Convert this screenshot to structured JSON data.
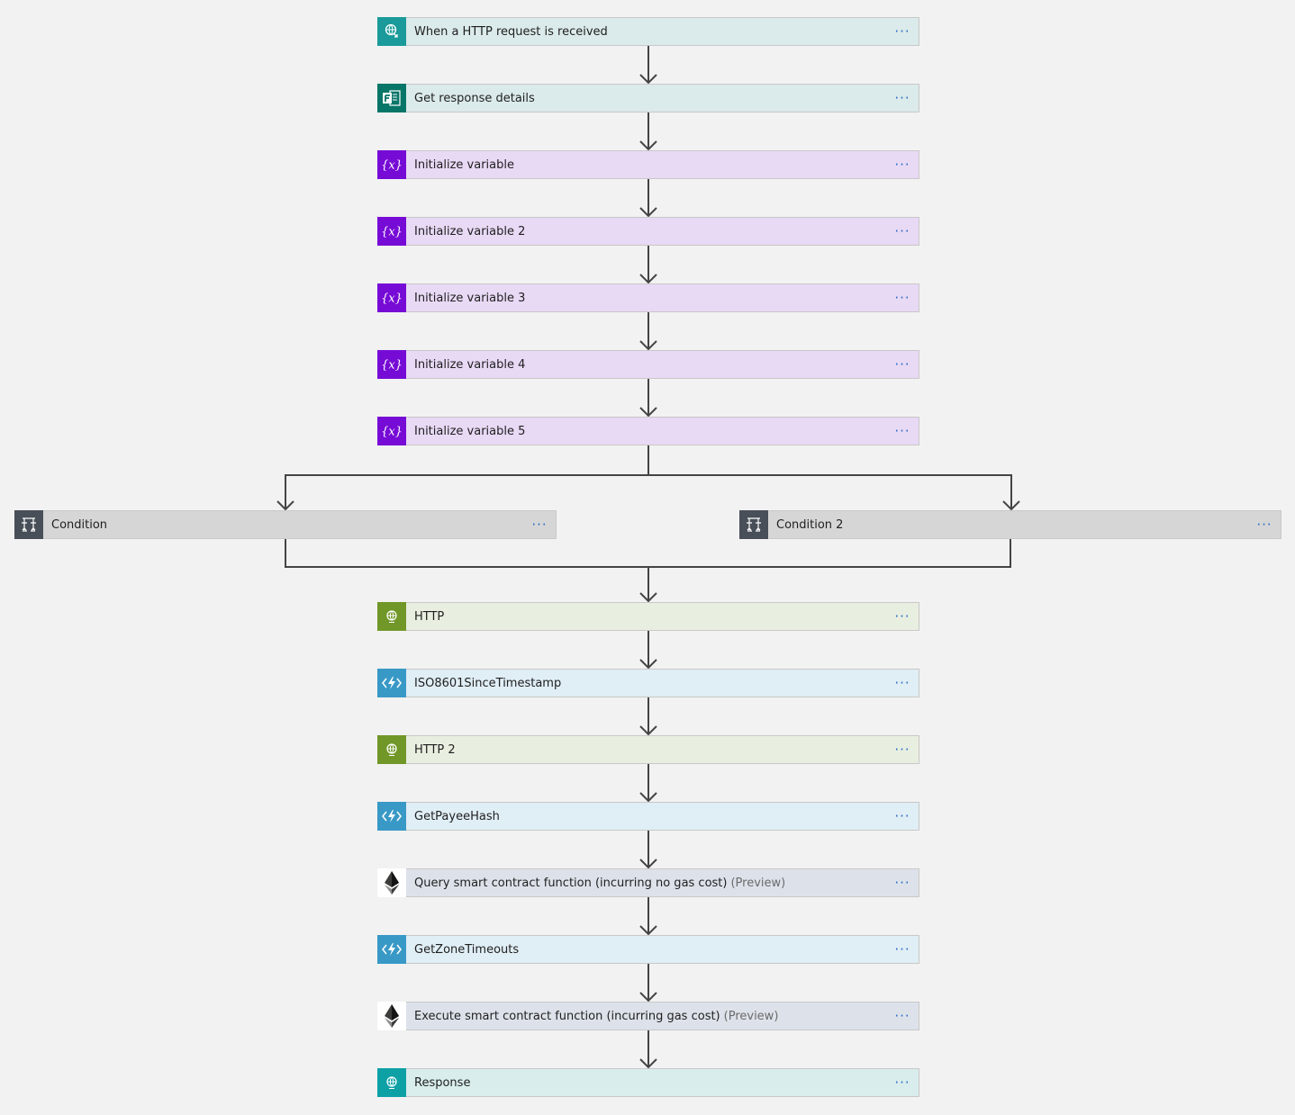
{
  "steps": [
    {
      "title": "When a HTTP request is received",
      "icon": "http-request-trigger-icon"
    },
    {
      "title": "Get response details",
      "icon": "forms-icon"
    },
    {
      "title": "Initialize variable",
      "icon": "variable-icon"
    },
    {
      "title": "Initialize variable 2",
      "icon": "variable-icon"
    },
    {
      "title": "Initialize variable 3",
      "icon": "variable-icon"
    },
    {
      "title": "Initialize variable 4",
      "icon": "variable-icon"
    },
    {
      "title": "Initialize variable 5",
      "icon": "variable-icon"
    }
  ],
  "conditions": [
    {
      "title": "Condition",
      "icon": "condition-icon"
    },
    {
      "title": "Condition 2",
      "icon": "condition-icon"
    }
  ],
  "after_steps": [
    {
      "title": "HTTP",
      "icon": "http-globe-icon"
    },
    {
      "title": "ISO8601SinceTimestamp",
      "icon": "azure-function-icon"
    },
    {
      "title": "HTTP 2",
      "icon": "http-globe-icon"
    },
    {
      "title": "GetPayeeHash",
      "icon": "azure-function-icon"
    },
    {
      "title": "Query smart contract function (incurring no gas cost)",
      "suffix": "(Preview)",
      "icon": "ethereum-icon"
    },
    {
      "title": "GetZoneTimeouts",
      "icon": "azure-function-icon"
    },
    {
      "title": "Execute smart contract function (incurring gas cost)",
      "suffix": "(Preview)",
      "icon": "ethereum-icon"
    },
    {
      "title": "Response",
      "icon": "response-globe-icon"
    }
  ],
  "more_label": "···",
  "colors": {
    "teal_icon": "#1a9a9a",
    "teal_bg": "#dbeaea",
    "forms_icon": "#077568",
    "forms_bg": "#dbeaea",
    "variable_icon": "#770bd6",
    "variable_bg": "#e8d9f5",
    "condition_icon": "#484f58",
    "condition_bg": "#d6d6d6",
    "http_icon": "#709727",
    "http_bg": "#e8efe0",
    "function_icon": "#3999c6",
    "function_bg": "#e0eef5",
    "ethereum_icon": "#ffffff",
    "ethereum_bg": "#dde2ea",
    "response_icon": "#0da1a6",
    "response_bg": "#d9eded"
  }
}
